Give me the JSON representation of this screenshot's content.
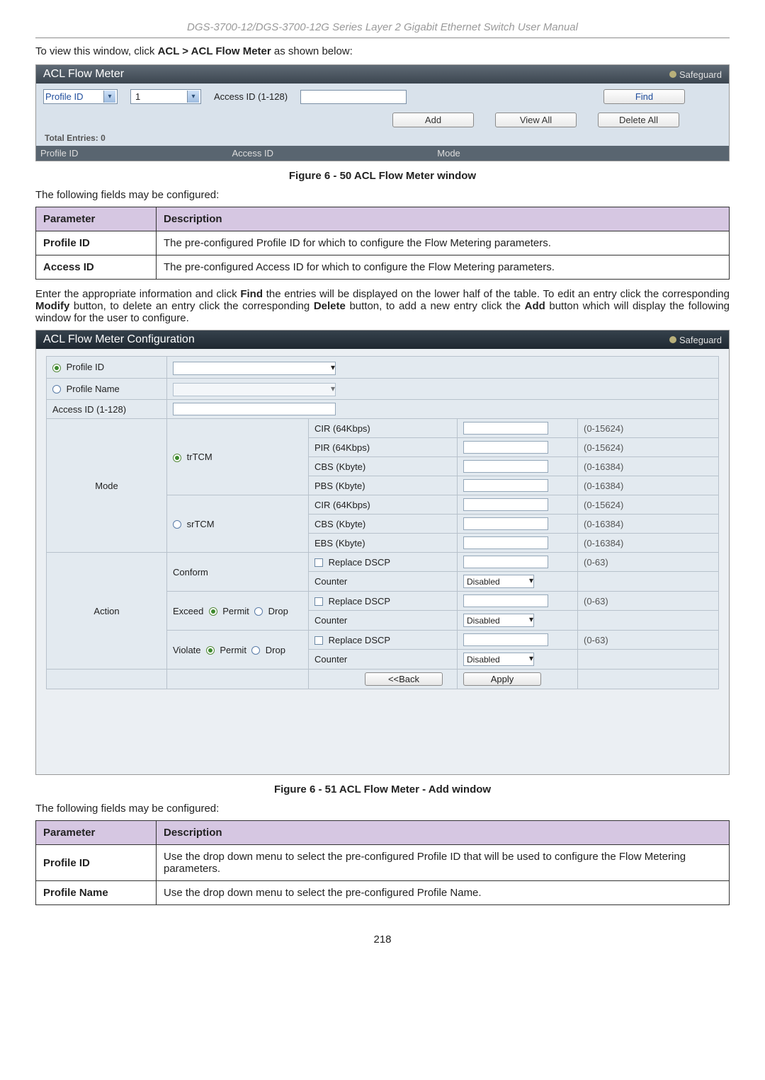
{
  "header": "DGS-3700-12/DGS-3700-12G Series Layer 2 Gigabit Ethernet Switch User Manual",
  "intro": {
    "prefix": "To view this window, click ",
    "bold": "ACL > ACL Flow Meter",
    "suffix": " as shown below:"
  },
  "panel1": {
    "title": "ACL Flow Meter",
    "safeguard": "Safeguard",
    "profile_id_label": "Profile ID",
    "profile_id_value": "1",
    "access_id_label": "Access ID (1-128)",
    "find_btn": "Find",
    "add_btn": "Add",
    "viewall_btn": "View All",
    "deleteall_btn": "Delete All",
    "total_entries": "Total Entries: 0",
    "grid": {
      "c1": "Profile ID",
      "c2": "Access ID",
      "c3": "Mode"
    }
  },
  "fig1": "Figure 6 - 50 ACL Flow Meter window",
  "para1": "The following fields may be configured:",
  "table1": {
    "h1": "Parameter",
    "h2": "Description",
    "rows": [
      {
        "p": "Profile ID",
        "d": "The pre-configured Profile ID for which to configure the Flow Metering parameters."
      },
      {
        "p": "Access ID",
        "d": "The pre-configured Access ID for which to configure the Flow Metering parameters."
      }
    ]
  },
  "para2": {
    "a": "Enter the appropriate information and click ",
    "b": "Find",
    "c": " the entries will be displayed on the lower half of the table. To edit an entry click the corresponding ",
    "d": "Modify",
    "e": " button, to delete an entry click the corresponding ",
    "f": "Delete",
    "g": " button, to add a new entry click the ",
    "h": "Add",
    "i": " button which will display the following window for the user to configure."
  },
  "cfg": {
    "title": "ACL Flow Meter Configuration",
    "safeguard": "Safeguard",
    "profile_id": "Profile ID",
    "profile_name": "Profile Name",
    "access_id": "Access ID (1-128)",
    "mode": "Mode",
    "trtcm": "trTCM",
    "srtcm": "srTCM",
    "cir": "CIR (64Kbps)",
    "pir": "PIR (64Kbps)",
    "cbs": "CBS (Kbyte)",
    "pbs": "PBS (Kbyte)",
    "ebs": "EBS (Kbyte)",
    "r_0_15624": "(0-15624)",
    "r_0_16384": "(0-16384)",
    "r_0_63": "(0-63)",
    "action": "Action",
    "conform": "Conform",
    "exceed": "Exceed",
    "violate": "Violate",
    "permit": "Permit",
    "drop": "Drop",
    "replace_dscp": "Replace DSCP",
    "counter": "Counter",
    "disabled": "Disabled",
    "back": "<<Back",
    "apply": "Apply"
  },
  "fig2": "Figure 6 - 51 ACL Flow Meter - Add window",
  "para3": "The following fields may be configured:",
  "table2": {
    "h1": "Parameter",
    "h2": "Description",
    "rows": [
      {
        "p": "Profile ID",
        "d": "Use the drop down menu to select the pre-configured Profile ID that will be used to configure the Flow Metering parameters."
      },
      {
        "p": "Profile Name",
        "d": "Use the drop down menu to select the pre-configured Profile Name."
      }
    ]
  },
  "page_number": "218"
}
